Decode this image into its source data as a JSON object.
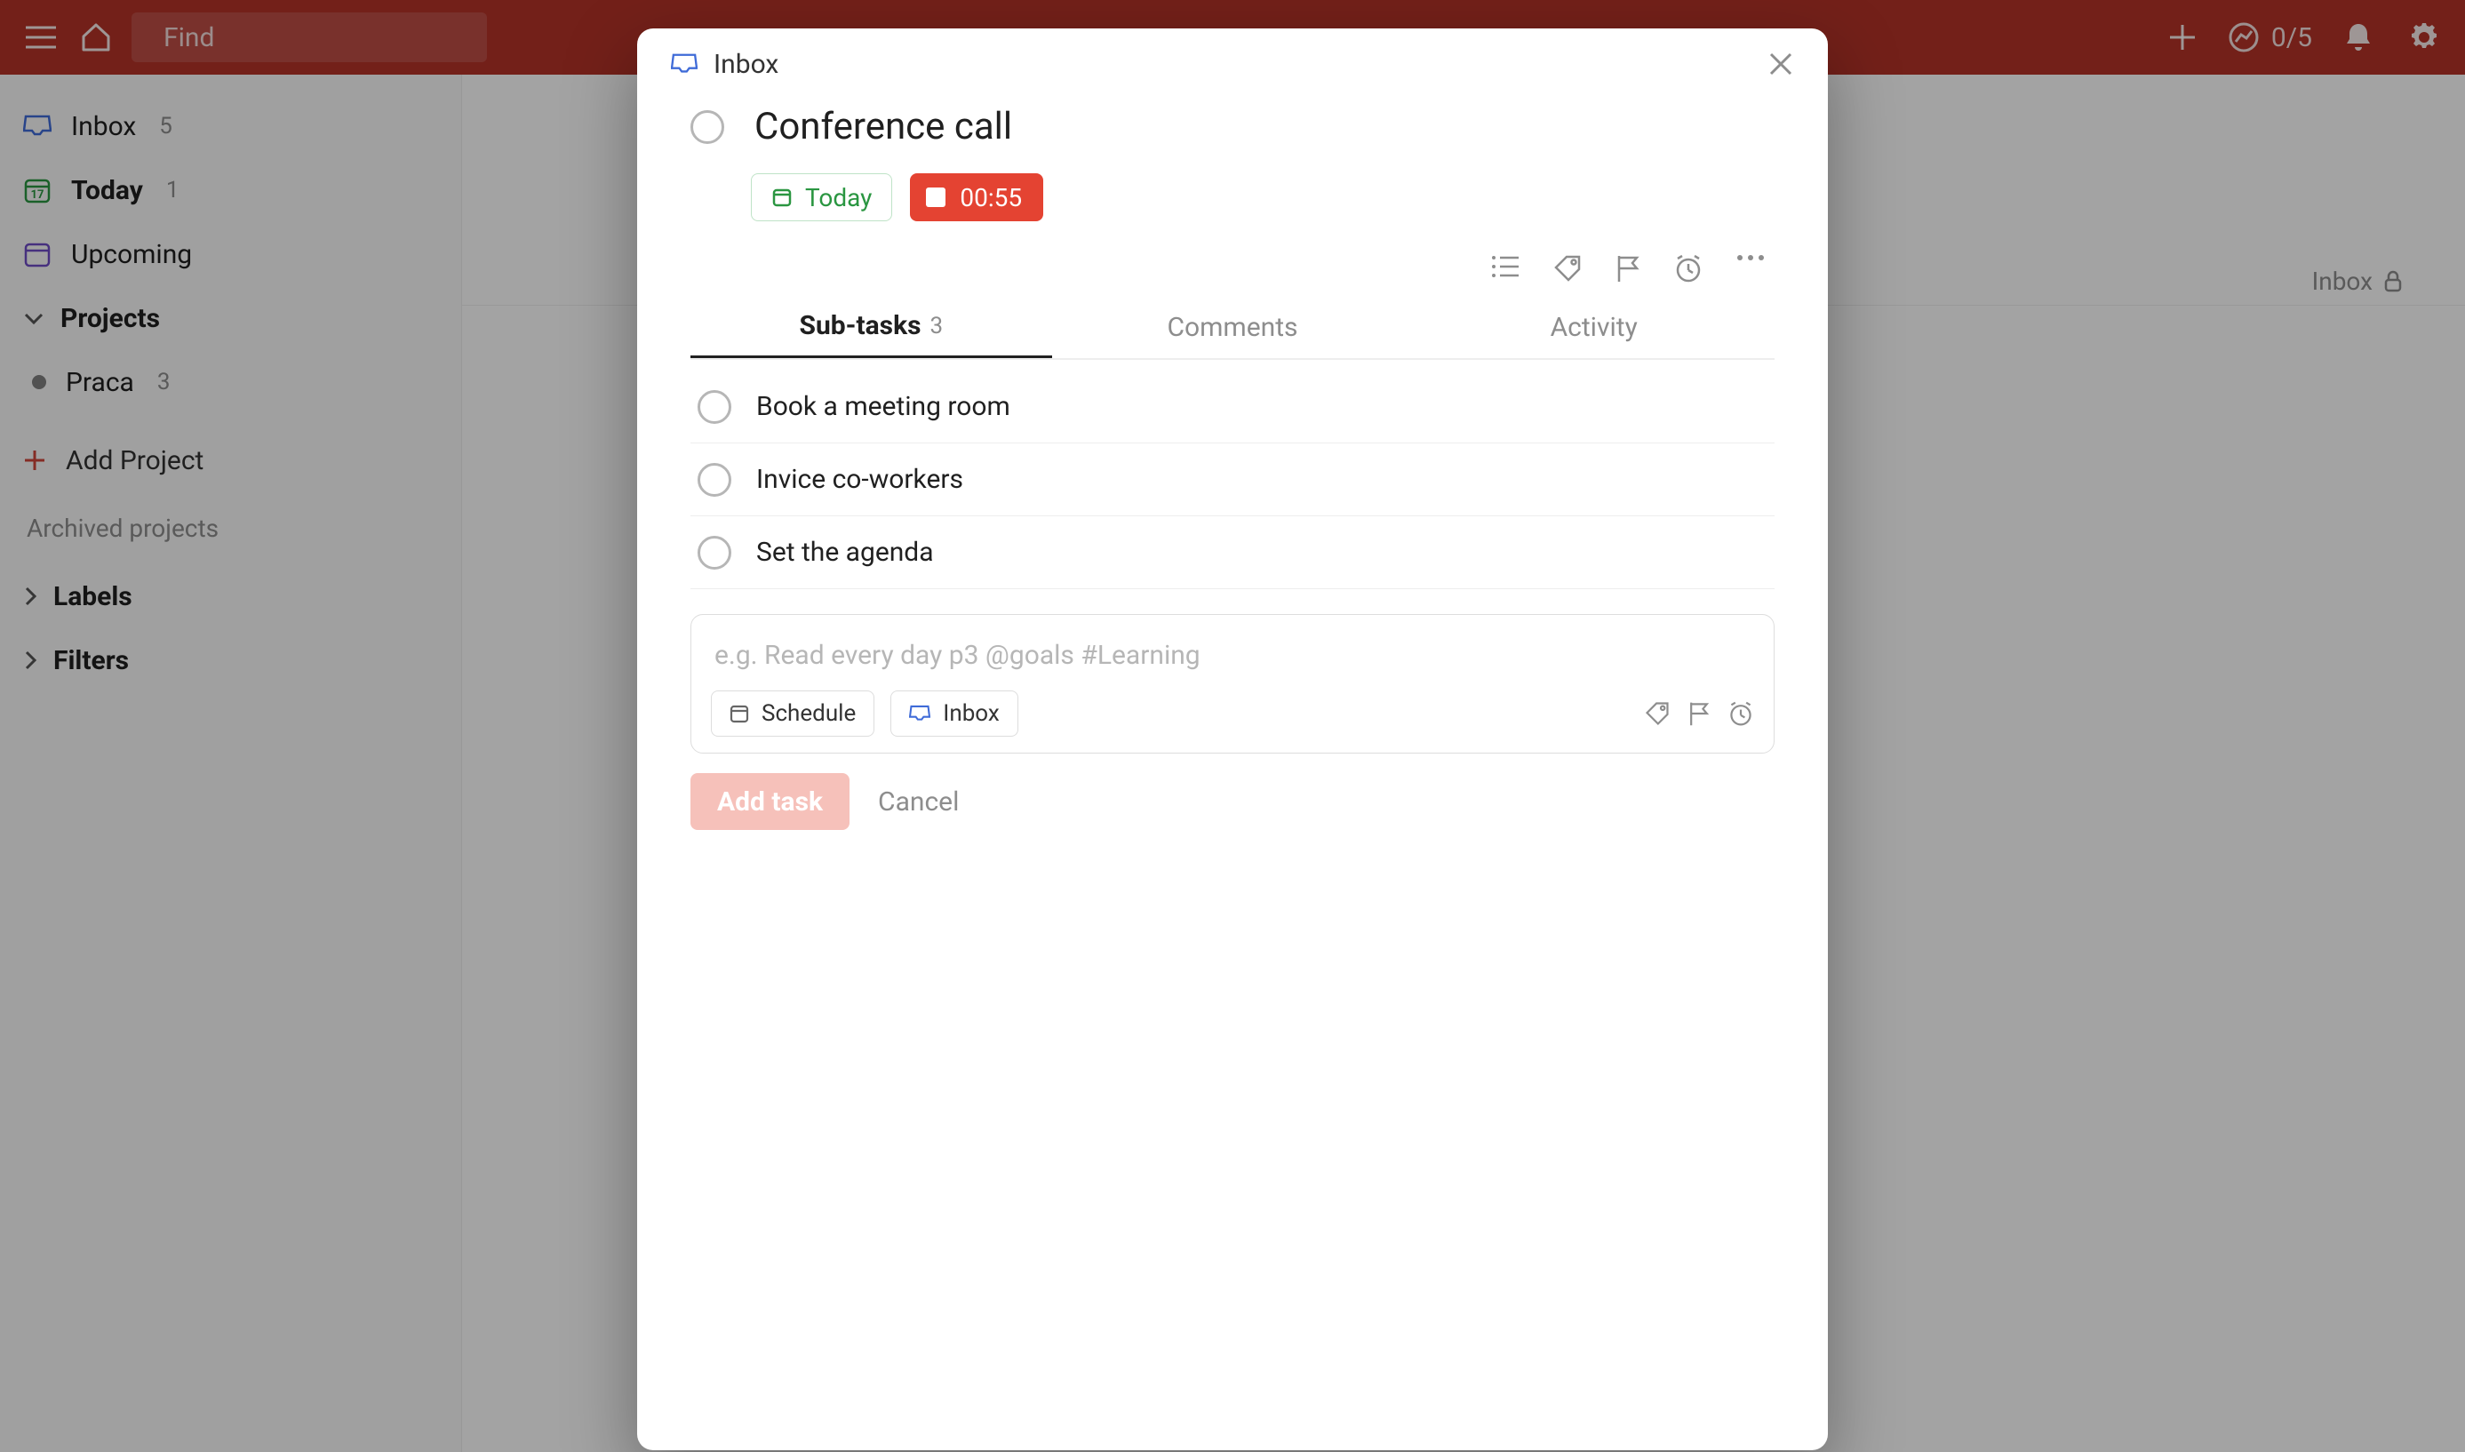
{
  "topbar": {
    "search_placeholder": "Find",
    "karma_score": "0/5"
  },
  "sidebar": {
    "inbox": {
      "label": "Inbox",
      "count": "5"
    },
    "today": {
      "label": "Today",
      "count": "1"
    },
    "upcoming": {
      "label": "Upcoming"
    },
    "projects_header": "Projects",
    "projects": [
      {
        "label": "Praca",
        "count": "3"
      }
    ],
    "add_project": "Add Project",
    "archived": "Archived projects",
    "labels_header": "Labels",
    "filters_header": "Filters"
  },
  "content": {
    "breadcrumb_label": "Inbox"
  },
  "modal": {
    "location": "Inbox",
    "task_title": "Conference call",
    "schedule_label": "Today",
    "timer": "00:55",
    "tabs": {
      "subtasks": {
        "label": "Sub-tasks",
        "count": "3"
      },
      "comments": {
        "label": "Comments"
      },
      "activity": {
        "label": "Activity"
      }
    },
    "subtasks": [
      "Book a meeting room",
      "Invice co-workers",
      "Set the agenda"
    ],
    "new_task": {
      "placeholder": "e.g. Read every day p3 @goals #Learning",
      "schedule": "Schedule",
      "project": "Inbox"
    },
    "add_button": "Add task",
    "cancel_button": "Cancel"
  }
}
